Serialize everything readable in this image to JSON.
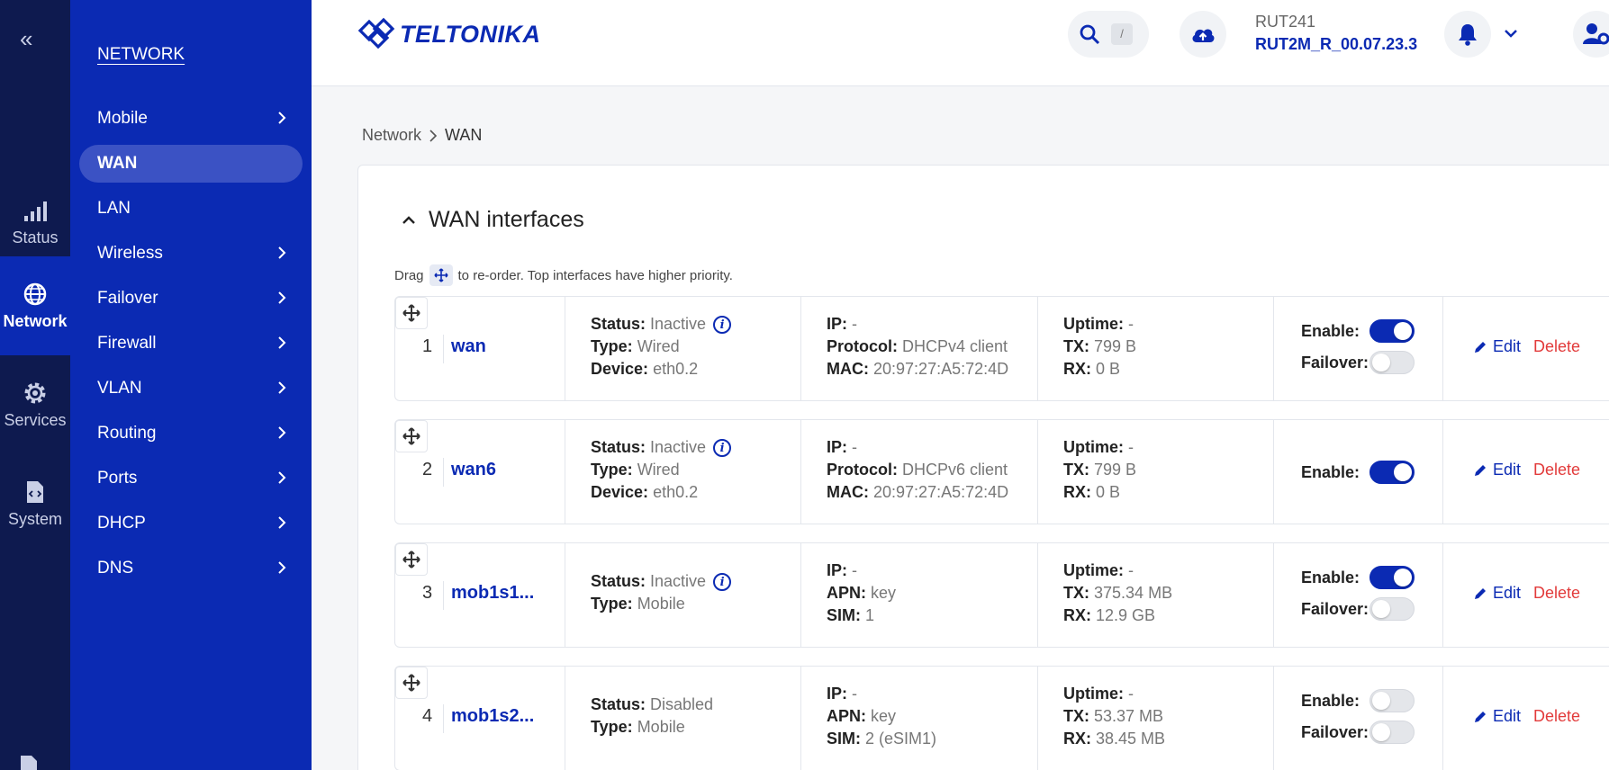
{
  "rail": {
    "items": [
      {
        "label": "Status",
        "icon": "signal-bars-icon"
      },
      {
        "label": "Network",
        "icon": "globe-icon",
        "active": true
      },
      {
        "label": "Services",
        "icon": "gear-icon"
      },
      {
        "label": "System",
        "icon": "file-code-icon"
      }
    ]
  },
  "subnav": {
    "section": "NETWORK",
    "items": [
      {
        "label": "Mobile",
        "chevron": true
      },
      {
        "label": "WAN",
        "active": true
      },
      {
        "label": "LAN"
      },
      {
        "label": "Wireless",
        "chevron": true
      },
      {
        "label": "Failover",
        "chevron": true
      },
      {
        "label": "Firewall",
        "chevron": true
      },
      {
        "label": "VLAN",
        "chevron": true
      },
      {
        "label": "Routing",
        "chevron": true
      },
      {
        "label": "Ports",
        "chevron": true
      },
      {
        "label": "DHCP",
        "chevron": true
      },
      {
        "label": "DNS",
        "chevron": true
      }
    ]
  },
  "header": {
    "logo": "TELTONIKA",
    "search_shortcut": "/",
    "device_name": "RUT241",
    "firmware": "RUT2M_R_00.07.23.3"
  },
  "breadcrumb": {
    "parent": "Network",
    "current": "WAN"
  },
  "main": {
    "card_title": "WAN interfaces",
    "hint_before": "Drag",
    "hint_after": "to re-order. Top interfaces have higher priority.",
    "interfaces": [
      {
        "num": "1",
        "name": "wan",
        "status_label": "Status:",
        "status": "Inactive",
        "type_label": "Type:",
        "type": "Wired",
        "device_label": "Device:",
        "device": "eth0.2",
        "ip_label": "IP:",
        "ip": "-",
        "proto_label": "Protocol:",
        "proto": "DHCPv4 client",
        "mac_label": "MAC:",
        "mac": "20:97:27:A5:72:4D",
        "uptime_label": "Uptime:",
        "uptime": "-",
        "tx_label": "TX:",
        "tx": "799 B",
        "rx_label": "RX:",
        "rx": "0 B",
        "enable_label": "Enable:",
        "enable": true,
        "failover_label": "Failover:",
        "failover": false,
        "edit": "Edit",
        "delete": "Delete"
      },
      {
        "num": "2",
        "name": "wan6",
        "status_label": "Status:",
        "status": "Inactive",
        "type_label": "Type:",
        "type": "Wired",
        "device_label": "Device:",
        "device": "eth0.2",
        "ip_label": "IP:",
        "ip": "-",
        "proto_label": "Protocol:",
        "proto": "DHCPv6 client",
        "mac_label": "MAC:",
        "mac": "20:97:27:A5:72:4D",
        "uptime_label": "Uptime:",
        "uptime": "-",
        "tx_label": "TX:",
        "tx": "799 B",
        "rx_label": "RX:",
        "rx": "0 B",
        "enable_label": "Enable:",
        "enable": true,
        "edit": "Edit",
        "delete": "Delete"
      },
      {
        "num": "3",
        "name": "mob1s1...",
        "status_label": "Status:",
        "status": "Inactive",
        "type_label": "Type:",
        "type": "Mobile",
        "ip_label": "IP:",
        "ip": "-",
        "apn_label": "APN:",
        "apn": "key",
        "sim_label": "SIM:",
        "sim": "1",
        "uptime_label": "Uptime:",
        "uptime": "-",
        "tx_label": "TX:",
        "tx": "375.34 MB",
        "rx_label": "RX:",
        "rx": "12.9 GB",
        "enable_label": "Enable:",
        "enable": true,
        "failover_label": "Failover:",
        "failover": false,
        "edit": "Edit",
        "delete": "Delete"
      },
      {
        "num": "4",
        "name": "mob1s2...",
        "status_label": "Status:",
        "status": "Disabled",
        "type_label": "Type:",
        "type": "Mobile",
        "ip_label": "IP:",
        "ip": "-",
        "apn_label": "APN:",
        "apn": "key",
        "sim_label": "SIM:",
        "sim": "2 (eSIM1)",
        "uptime_label": "Uptime:",
        "uptime": "-",
        "tx_label": "TX:",
        "tx": "53.37 MB",
        "rx_label": "RX:",
        "rx": "38.45 MB",
        "enable_label": "Enable:",
        "enable": false,
        "failover_label": "Failover:",
        "failover": false,
        "edit": "Edit",
        "delete": "Delete"
      }
    ]
  },
  "colors": {
    "rail": "#0e1a4f",
    "nav": "#0b2ab3",
    "accent": "#0b2ab3",
    "danger": "#e23b3b"
  }
}
